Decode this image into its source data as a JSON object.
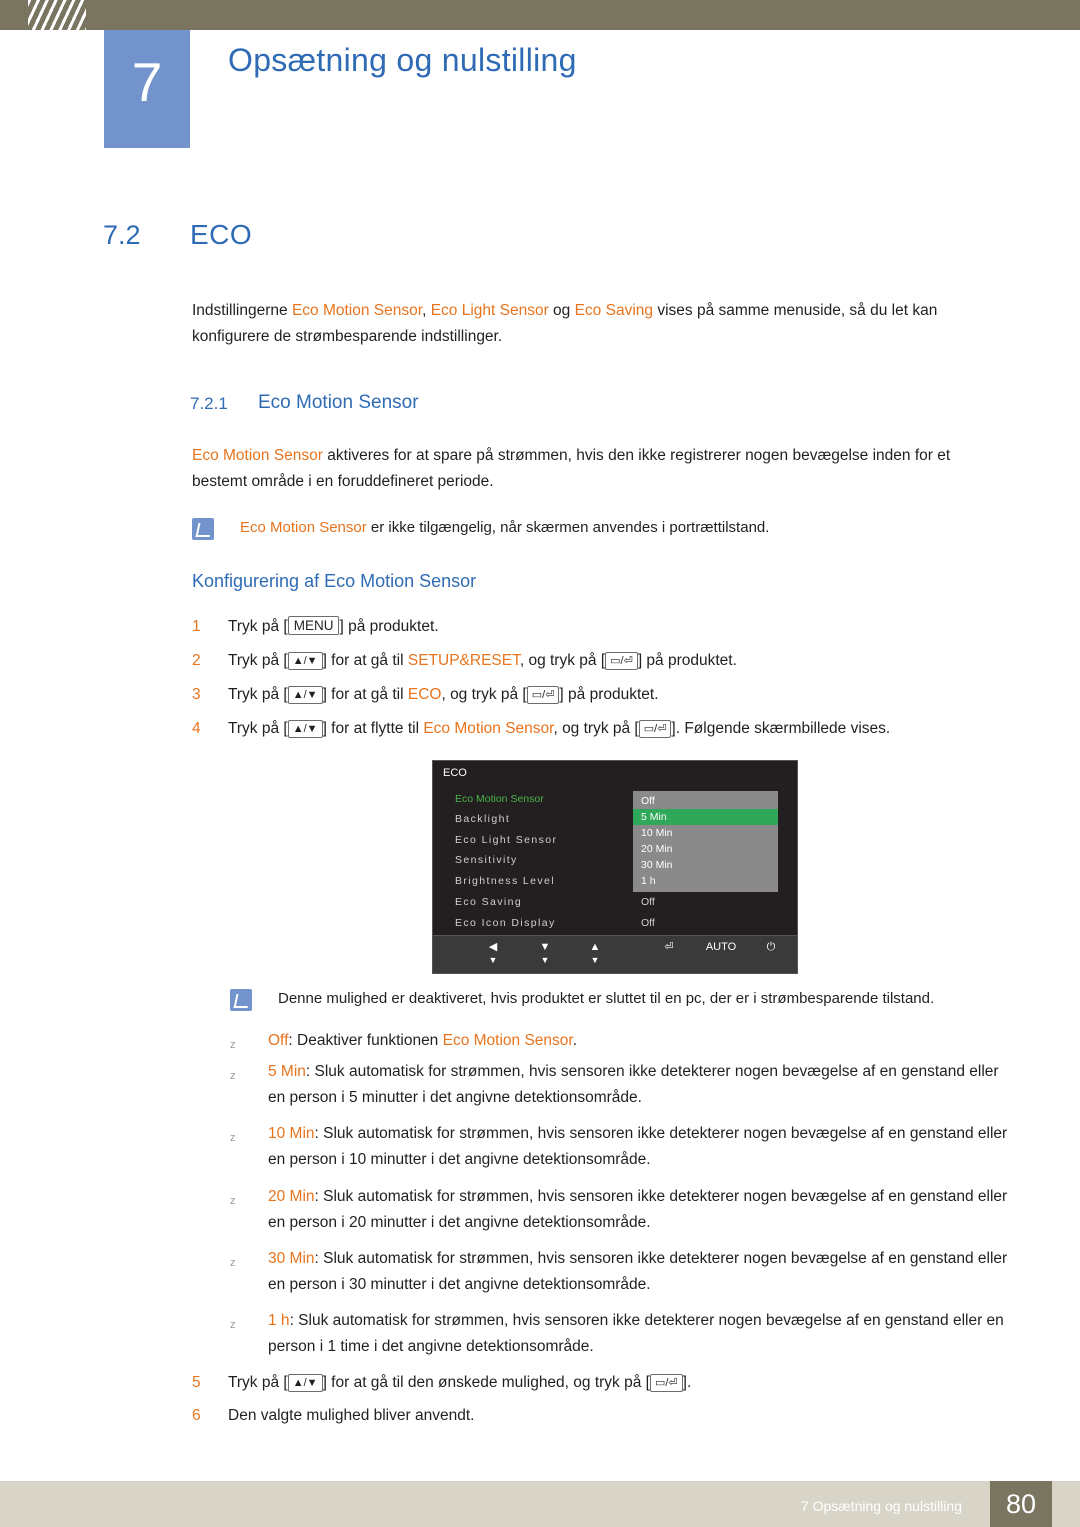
{
  "header": {
    "chapter_number": "7",
    "chapter_title": "Opsætning og nulstilling"
  },
  "section": {
    "number": "7.2",
    "title": "ECO",
    "intro_parts": {
      "t1": "Indstillingerne ",
      "t2": "Eco Motion Sensor",
      "t3": ", ",
      "t4": "Eco Light Sensor",
      "t5": " og ",
      "t6": "Eco Saving",
      "t7": " vises på samme menuside, så du let kan konfigurere de strømbesparende indstillinger."
    }
  },
  "subsection": {
    "number": "7.2.1",
    "title": "Eco Motion Sensor",
    "para_parts": {
      "t1": "Eco Motion Sensor",
      "t2": " aktiveres for at spare på strømmen, hvis den ikke registrerer nogen bevægelse inden for et bestemt område i en foruddefineret periode."
    },
    "note1_parts": {
      "t1": "Eco Motion Sensor",
      "t2": " er ikke tilgængelig, når skærmen anvendes i portrættilstand."
    },
    "config_title": "Konfigurering af Eco Motion Sensor"
  },
  "steps": [
    {
      "num": "1",
      "parts": [
        {
          "text": "Tryk på [",
          "style": "plain"
        },
        {
          "text": "MENU",
          "style": "key"
        },
        {
          "text": "] på produktet.",
          "style": "plain"
        }
      ]
    },
    {
      "num": "2",
      "parts": [
        {
          "text": "Tryk på [",
          "style": "plain"
        },
        {
          "text": "▲/▼",
          "style": "keysmall"
        },
        {
          "text": "] for at gå til ",
          "style": "plain"
        },
        {
          "text": "SETUP&RESET",
          "style": "orange"
        },
        {
          "text": ", og tryk på [",
          "style": "plain"
        },
        {
          "text": "▭/⏎",
          "style": "keysmall"
        },
        {
          "text": "] på produktet.",
          "style": "plain"
        }
      ]
    },
    {
      "num": "3",
      "parts": [
        {
          "text": "Tryk på [",
          "style": "plain"
        },
        {
          "text": "▲/▼",
          "style": "keysmall"
        },
        {
          "text": "] for at gå til ",
          "style": "plain"
        },
        {
          "text": "ECO",
          "style": "orange"
        },
        {
          "text": ", og tryk på [",
          "style": "plain"
        },
        {
          "text": "▭/⏎",
          "style": "keysmall"
        },
        {
          "text": "] på produktet.",
          "style": "plain"
        }
      ]
    },
    {
      "num": "4",
      "parts": [
        {
          "text": "Tryk på [",
          "style": "plain"
        },
        {
          "text": "▲/▼",
          "style": "keysmall"
        },
        {
          "text": "] for at flytte til ",
          "style": "plain"
        },
        {
          "text": "Eco Motion Sensor",
          "style": "orange"
        },
        {
          "text": ", og tryk på [",
          "style": "plain"
        },
        {
          "text": "▭/⏎",
          "style": "keysmall"
        },
        {
          "text": "]. Følgende skærmbillede vises.",
          "style": "plain"
        }
      ]
    }
  ],
  "osd": {
    "title": "ECO",
    "rows": [
      {
        "label": "Eco Motion Sensor",
        "value": "",
        "selected": true
      },
      {
        "label": "Backlight",
        "value": "",
        "selected": false
      },
      {
        "label": "Eco Light Sensor",
        "value": "",
        "selected": false
      },
      {
        "label": "Sensitivity",
        "value": "",
        "selected": false
      },
      {
        "label": "Brightness Level",
        "value": "",
        "selected": false
      },
      {
        "label": "Eco Saving",
        "value": "Off",
        "selected": false
      },
      {
        "label": "Eco Icon Display",
        "value": "Off",
        "selected": false
      }
    ],
    "options": [
      "Off",
      "5 Min",
      "10 Min",
      "20 Min",
      "30 Min",
      "1 h"
    ],
    "active_option": "5 Min",
    "buttons": [
      {
        "glyph": "◀",
        "under": "▼"
      },
      {
        "glyph": "▼",
        "under": "▼"
      },
      {
        "glyph": "▲",
        "under": "▼"
      },
      {
        "glyph": "⏎",
        "under": ""
      },
      {
        "glyph": "AUTO",
        "under": ""
      },
      {
        "glyph": "⏻",
        "under": ""
      }
    ]
  },
  "note2": "Denne mulighed er deaktiveret, hvis produktet er sluttet til en pc, der er i strømbesparende tilstand.",
  "options_list": [
    {
      "term": "Off",
      "rest": ": Deaktiver funktionen ",
      "term2": "Eco Motion Sensor",
      "rest2": "."
    },
    {
      "term": "5 Min",
      "rest": ": Sluk automatisk for strømmen, hvis sensoren ikke detekterer nogen bevægelse af en genstand eller en person i 5 minutter i det angivne detektionsområde.",
      "term2": "",
      "rest2": ""
    },
    {
      "term": "10 Min",
      "rest": ": Sluk automatisk for strømmen, hvis sensoren ikke detekterer nogen bevægelse af en genstand eller en person i 10 minutter i det angivne detektionsområde.",
      "term2": "",
      "rest2": ""
    },
    {
      "term": "20 Min",
      "rest": ": Sluk automatisk for strømmen, hvis sensoren ikke detekterer nogen bevægelse af en genstand eller en person i 20 minutter i det angivne detektionsområde.",
      "term2": "",
      "rest2": ""
    },
    {
      "term": "30 Min",
      "rest": ": Sluk automatisk for strømmen, hvis sensoren ikke detekterer nogen bevægelse af en genstand eller en person i 30 minutter i det angivne detektionsområde.",
      "term2": "",
      "rest2": ""
    },
    {
      "term": "1 h",
      "rest": ": Sluk automatisk for strømmen, hvis sensoren ikke detekterer nogen bevægelse af en genstand eller en person i 1 time i det angivne detektionsområde.",
      "term2": "",
      "rest2": ""
    }
  ],
  "steps_end": [
    {
      "num": "5",
      "parts": [
        {
          "text": "Tryk på [",
          "style": "plain"
        },
        {
          "text": "▲/▼",
          "style": "keysmall"
        },
        {
          "text": "] for at gå til den ønskede mulighed, og tryk på [",
          "style": "plain"
        },
        {
          "text": "▭/⏎",
          "style": "keysmall"
        },
        {
          "text": "].",
          "style": "plain"
        }
      ]
    },
    {
      "num": "6",
      "parts": [
        {
          "text": "Den valgte mulighed bliver anvendt.",
          "style": "plain"
        }
      ]
    }
  ],
  "footer": {
    "text": "7 Opsætning og nulstilling",
    "page": "80"
  },
  "colors": {
    "accent_blue": "#2f6bb5",
    "accent_orange": "#e8741e",
    "header_bar": "#7a7561",
    "badge_blue": "#7293cb",
    "footer_bar": "#d8d4c8"
  }
}
